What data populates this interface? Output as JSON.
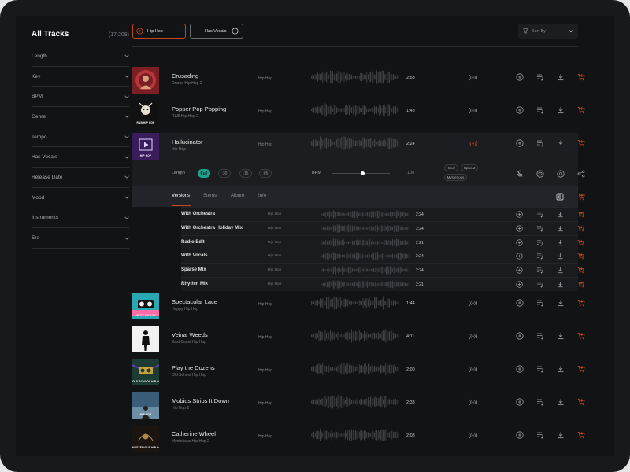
{
  "colors": {
    "accent": "#c4461f",
    "teal": "#1fa08d",
    "bg": "#121315"
  },
  "sidebar": {
    "title": "All Tracks",
    "count": "(17,208)",
    "filters": [
      "Length",
      "Key",
      "BPM",
      "Genre",
      "Tempo",
      "Has Vocals",
      "Release Date",
      "Mood",
      "Instruments",
      "Era"
    ]
  },
  "filterbar": {
    "chips": [
      {
        "label": "Hip Hop",
        "icon": "remove-circle-icon"
      },
      {
        "label": "Has Vocals",
        "icon": "minus-circle-icon"
      }
    ],
    "sort_label": "Sort By"
  },
  "tracks": [
    {
      "title": "Crusading",
      "sub": "Drama Hip Hop 2",
      "genre": "Hip Hop",
      "duration": "2:58",
      "cover": "#7a1f24"
    },
    {
      "title": "Popper Pop Popping",
      "sub": "R&B Hip Hop 2",
      "genre": "Hip Hop",
      "duration": "1:48",
      "cover": "#111",
      "cover_text": "R&B HIP HOP"
    },
    {
      "title": "Hallucinator",
      "sub": "Hip Hop",
      "genre": "Hip Hop",
      "duration": "2:24",
      "cover": "#3a1c5c",
      "cover_text": "HIP HOP"
    },
    {
      "title": "Spectacular Lace",
      "sub": "Happy Hip Hop",
      "genre": "Hip Hop",
      "duration": "1:44",
      "cover": "#29a8b4",
      "cover_text": "HAPPY HIP HOP"
    },
    {
      "title": "Veinal Weeds",
      "sub": "East Coast Hip Hop",
      "genre": "Hip Hop",
      "duration": "4:11",
      "cover": "#f2f2f2"
    },
    {
      "title": "Play the Dozens",
      "sub": "Old School Hip Hop",
      "genre": "Hip Hop",
      "duration": "2:00",
      "cover": "#1c3b33",
      "cover_text": "OLD SCHOOL HIP HOP"
    },
    {
      "title": "Mobius Strips It Down",
      "sub": "Hip Hop 2",
      "genre": "Hip Hop",
      "duration": "2:33",
      "cover": "#3b5d7a",
      "cover_text": "HIP HOP"
    },
    {
      "title": "Catherine Wheel",
      "sub": "Mysterious Hip Hop 2",
      "genre": "Hip Hop",
      "duration": "2:03",
      "cover": "#1a1511",
      "cover_text": "MYSTERIOUS HIP HOP"
    }
  ],
  "expanded": {
    "length_label": "Length",
    "length_options": [
      "Full",
      ":30",
      ":15",
      ":05"
    ],
    "selected_length": "Full",
    "bpm_label": "BPM",
    "bpm_value": "100",
    "tags": [
      "Cool",
      "Upbeat",
      "Mysterious"
    ]
  },
  "tabs": [
    "Versions",
    "Stems",
    "Album",
    "Info"
  ],
  "versions": [
    {
      "title": "With Orchestra",
      "genre": "Hip Hop",
      "duration": "2:24"
    },
    {
      "title": "With Orchestra Holiday Mix",
      "genre": "Hip Hop",
      "duration": "2:24"
    },
    {
      "title": "Radio Edit",
      "genre": "Hip Hop",
      "duration": "2:21"
    },
    {
      "title": "With Vocals",
      "genre": "Hip Hop",
      "duration": "2:24"
    },
    {
      "title": "Sparse Mix",
      "genre": "Hip Hop",
      "duration": "2:24"
    },
    {
      "title": "Rhythm Mix",
      "genre": "Hip Hop",
      "duration": "2:21"
    }
  ]
}
